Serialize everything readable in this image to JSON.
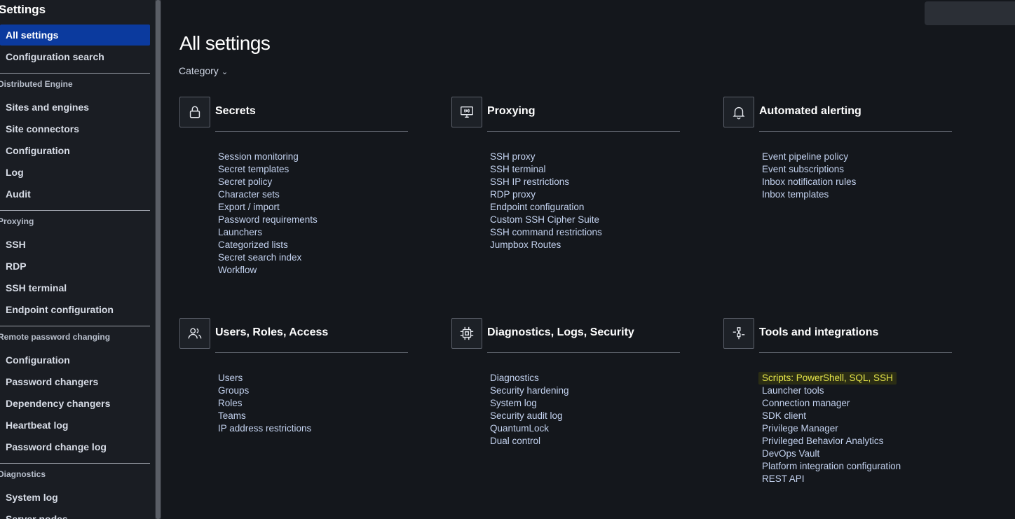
{
  "sidebar": {
    "title": "Settings",
    "top_items": [
      {
        "label": "All settings",
        "active": true
      },
      {
        "label": "Configuration search"
      }
    ],
    "sections": [
      {
        "heading": "Distributed Engine",
        "items": [
          "Sites and engines",
          "Site connectors",
          "Configuration",
          "Log",
          "Audit"
        ]
      },
      {
        "heading": "Proxying",
        "items": [
          "SSH",
          "RDP",
          "SSH terminal",
          "Endpoint configuration"
        ]
      },
      {
        "heading": "Remote password changing",
        "items": [
          "Configuration",
          "Password changers",
          "Dependency changers",
          "Heartbeat log",
          "Password change log"
        ]
      },
      {
        "heading": "Diagnostics",
        "items": [
          "System log",
          "Server nodes"
        ]
      }
    ]
  },
  "main": {
    "title": "All settings",
    "filter_label": "Category",
    "cards": [
      {
        "title": "Secrets",
        "icon": "lock-icon",
        "links": [
          "Session monitoring",
          "Secret templates",
          "Secret policy",
          "Character sets",
          "Export / import",
          "Password requirements",
          "Launchers",
          "Categorized lists",
          "Secret search index",
          "Workflow"
        ]
      },
      {
        "title": "Proxying",
        "icon": "monitor-signal-icon",
        "links": [
          "SSH proxy",
          "SSH terminal",
          "SSH IP restrictions",
          "RDP proxy",
          "Endpoint configuration",
          "Custom SSH Cipher Suite",
          "SSH command restrictions",
          "Jumpbox Routes"
        ]
      },
      {
        "title": "Automated alerting",
        "icon": "bell-icon",
        "links": [
          "Event pipeline policy",
          "Event subscriptions",
          "Inbox notification rules",
          "Inbox templates"
        ]
      },
      {
        "title": "Users, Roles, Access",
        "icon": "users-icon",
        "links": [
          "Users",
          "Groups",
          "Roles",
          "Teams",
          "IP address restrictions"
        ]
      },
      {
        "title": "Diagnostics, Logs, Security",
        "icon": "chip-icon",
        "links": [
          "Diagnostics",
          "Security hardening",
          "System log",
          "Security audit log",
          "QuantumLock",
          "Dual control"
        ]
      },
      {
        "title": "Tools and integrations",
        "icon": "integration-icon",
        "links": [
          "Scripts: PowerShell, SQL, SSH",
          "Launcher tools",
          "Connection manager",
          "SDK client",
          "Privilege Manager",
          "Privileged Behavior Analytics",
          "DevOps Vault",
          "Platform integration configuration",
          "REST API"
        ]
      }
    ]
  },
  "colors": {
    "background": "#14171c",
    "sidebar": "#1a1d23",
    "active_item": "#0b3a9e",
    "link": "#c3d2ef",
    "highlight_text": "#e6e64a"
  }
}
